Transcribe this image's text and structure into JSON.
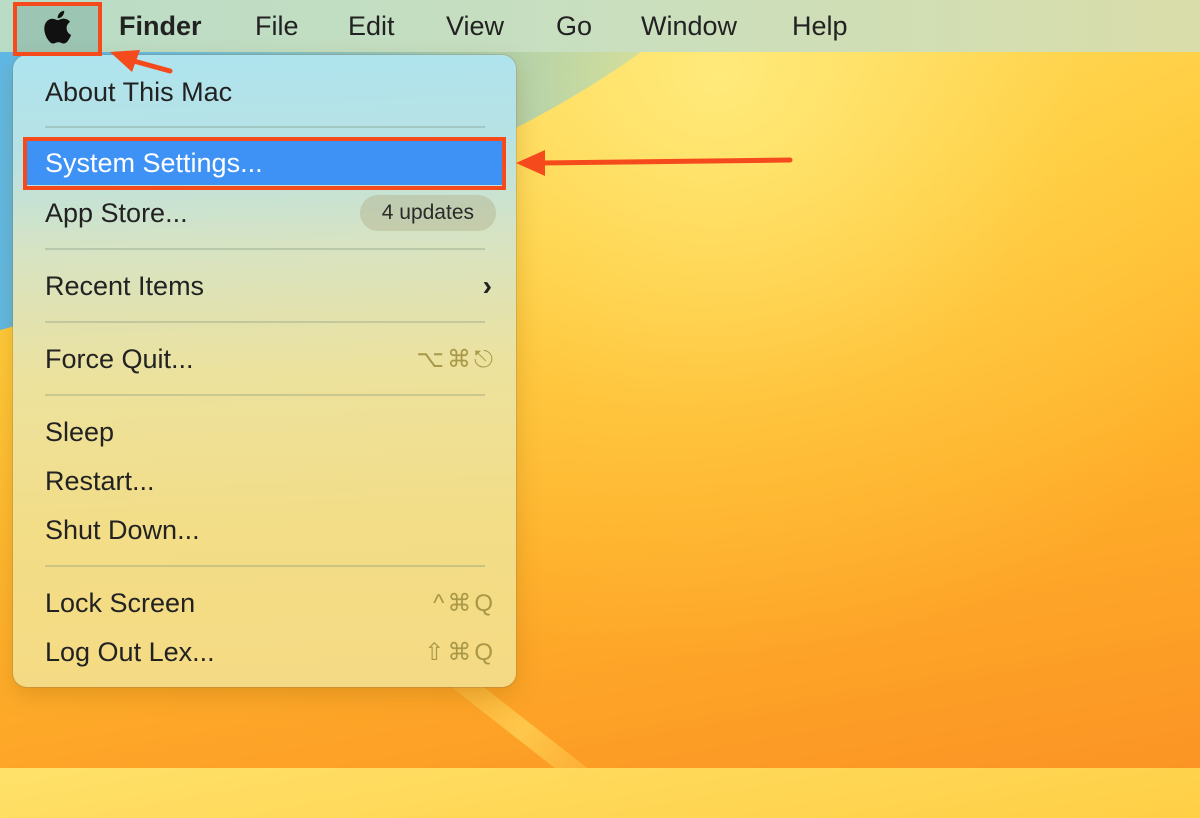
{
  "menubar": {
    "apple_icon": "apple-logo-icon",
    "app_name": "Finder",
    "items": [
      "File",
      "Edit",
      "View",
      "Go",
      "Window",
      "Help"
    ]
  },
  "apple_menu": {
    "about": "About This Mac",
    "system_settings": "System Settings...",
    "app_store": "App Store...",
    "app_store_badge": "4 updates",
    "recent_items": "Recent Items",
    "recent_items_chevron": "›",
    "force_quit": "Force Quit...",
    "force_quit_shortcut": "⌥⌘⎋",
    "sleep": "Sleep",
    "restart": "Restart...",
    "shut_down": "Shut Down...",
    "lock_screen": "Lock Screen",
    "lock_screen_shortcut": "^⌘Q",
    "log_out": "Log Out Lex...",
    "log_out_shortcut": "⇧⌘Q"
  },
  "annotations": {
    "color": "#f44a1c",
    "highlight_color": "#3f92f5"
  }
}
